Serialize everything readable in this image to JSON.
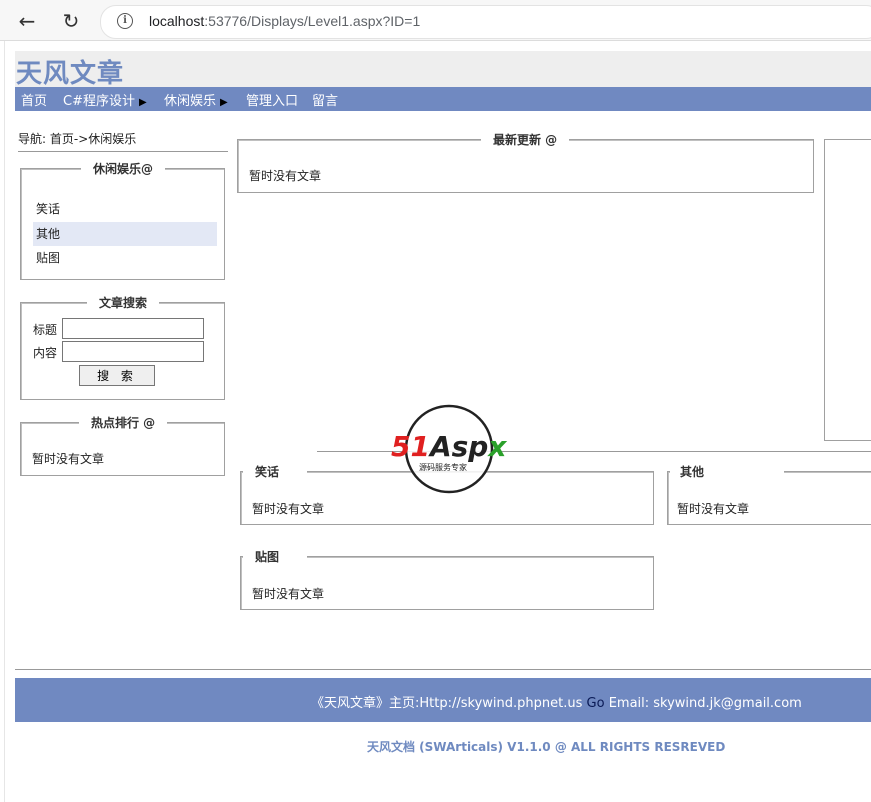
{
  "browser": {
    "url_host": "localhost",
    "url_rest": ":53776/Displays/Level1.aspx?ID=1"
  },
  "site": {
    "title": "天风文章"
  },
  "menu": [
    {
      "label": "首页",
      "has_arrow": false
    },
    {
      "label": "C#程序设计",
      "has_arrow": true
    },
    {
      "label": "休闲娱乐",
      "has_arrow": true
    },
    {
      "label": "管理入口",
      "has_arrow": false
    },
    {
      "label": "留言",
      "has_arrow": false
    }
  ],
  "breadcrumb": "导航: 首页->休闲娱乐",
  "category_box": {
    "legend": "休闲娱乐@",
    "items": [
      "笑话",
      "其他",
      "贴图"
    ],
    "highlighted_index": 1
  },
  "search_box": {
    "legend": "文章搜索",
    "title_label": "标题",
    "content_label": "内容",
    "title_value": "",
    "content_value": "",
    "button_label": "搜 索"
  },
  "hot_box": {
    "legend": "热点排行 @",
    "empty_text": "暂时没有文章"
  },
  "latest_box": {
    "legend": "最新更新 @",
    "empty_text": "暂时没有文章"
  },
  "sub_boxes": [
    {
      "legend": "笑话",
      "empty_text": "暂时没有文章"
    },
    {
      "legend": "其他",
      "empty_text": "暂时没有文章"
    },
    {
      "legend": "贴图",
      "empty_text": "暂时没有文章"
    }
  ],
  "watermark": {
    "brand": "51Aspx",
    "tagline": "源码服务专家"
  },
  "footer": {
    "text": "《天风文章》主页:Http://skywind.phpnet.us",
    "go": "Go",
    "email": "Email: skywind.jk@gmail.com",
    "copyright": "天风文档 (SWArticals) V1.1.0 @ ALL RIGHTS RESREVED"
  },
  "colors": {
    "accent": "#7089c1",
    "title": "#6f8ac0"
  }
}
